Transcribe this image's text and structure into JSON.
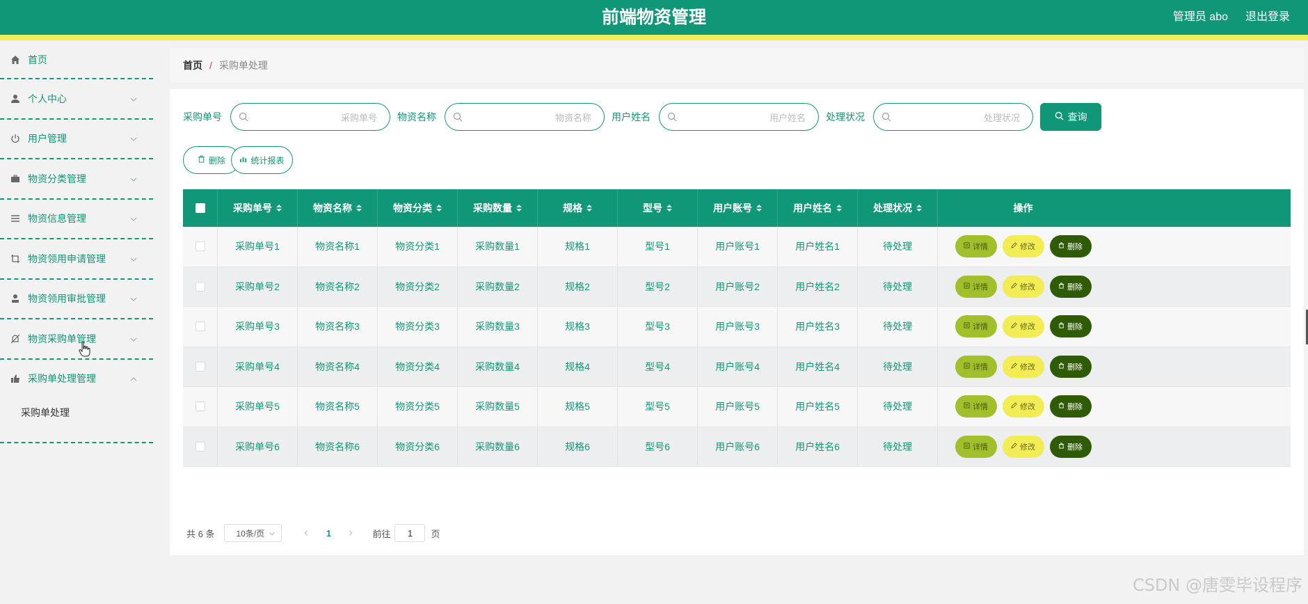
{
  "header": {
    "title": "前端物资管理",
    "user": "管理员 abo",
    "logout": "退出登录"
  },
  "sidebar": {
    "items": [
      {
        "label": "首页",
        "icon": "home-icon"
      },
      {
        "label": "个人中心",
        "icon": "user-icon"
      },
      {
        "label": "用户管理",
        "icon": "power-icon"
      },
      {
        "label": "物资分类管理",
        "icon": "briefcase-icon"
      },
      {
        "label": "物资信息管理",
        "icon": "list-icon"
      },
      {
        "label": "物资领用申请管理",
        "icon": "crop-icon"
      },
      {
        "label": "物资领用审批管理",
        "icon": "person-icon"
      },
      {
        "label": "物资采购单管理",
        "icon": "bell-off-icon"
      },
      {
        "label": "采购单处理管理",
        "icon": "thumb-up-icon"
      }
    ],
    "submenu": "采购单处理"
  },
  "breadcrumb": {
    "home": "首页",
    "separator": "/",
    "current": "采购单处理"
  },
  "search": {
    "fields": [
      {
        "label": "采购单号",
        "placeholder": "采购单号"
      },
      {
        "label": "物资名称",
        "placeholder": "物资名称"
      },
      {
        "label": "用户姓名",
        "placeholder": "用户姓名"
      },
      {
        "label": "处理状况",
        "placeholder": "处理状况"
      }
    ],
    "query_label": "查询"
  },
  "actions": {
    "delete_label": "删除",
    "report_label": "统计报表"
  },
  "table": {
    "columns": [
      "采购单号",
      "物资名称",
      "物资分类",
      "采购数量",
      "规格",
      "型号",
      "用户账号",
      "用户姓名",
      "处理状况",
      "操作"
    ],
    "rows": [
      [
        "采购单号1",
        "物资名称1",
        "物资分类1",
        "采购数量1",
        "规格1",
        "型号1",
        "用户账号1",
        "用户姓名1",
        "待处理"
      ],
      [
        "采购单号2",
        "物资名称2",
        "物资分类2",
        "采购数量2",
        "规格2",
        "型号2",
        "用户账号2",
        "用户姓名2",
        "待处理"
      ],
      [
        "采购单号3",
        "物资名称3",
        "物资分类3",
        "采购数量3",
        "规格3",
        "型号3",
        "用户账号3",
        "用户姓名3",
        "待处理"
      ],
      [
        "采购单号4",
        "物资名称4",
        "物资分类4",
        "采购数量4",
        "规格4",
        "型号4",
        "用户账号4",
        "用户姓名4",
        "待处理"
      ],
      [
        "采购单号5",
        "物资名称5",
        "物资分类5",
        "采购数量5",
        "规格5",
        "型号5",
        "用户账号5",
        "用户姓名5",
        "待处理"
      ],
      [
        "采购单号6",
        "物资名称6",
        "物资分类6",
        "采购数量6",
        "规格6",
        "型号6",
        "用户账号6",
        "用户姓名6",
        "待处理"
      ]
    ],
    "row_actions": {
      "detail": "详情",
      "edit": "修改",
      "delete": "删除"
    }
  },
  "pagination": {
    "total": "共 6 条",
    "page_size": "10条/页",
    "current_page": "1",
    "goto_label": "前往",
    "goto_value": "1",
    "goto_suffix": "页"
  },
  "watermark": "CSDN @唐雯毕设程序",
  "colors": {
    "primary": "#109777",
    "accent_yellow": "#f2ec55",
    "detail_green": "#a0bf2a",
    "delete_dark": "#2f5a06"
  }
}
